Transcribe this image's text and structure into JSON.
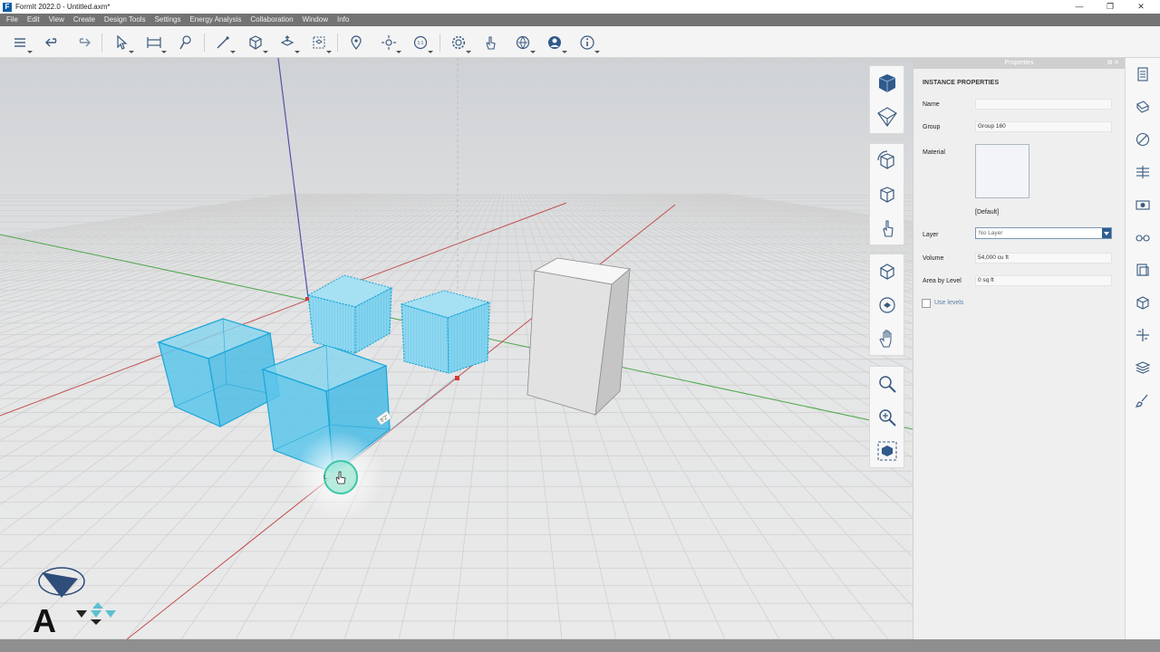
{
  "window": {
    "title": "FormIt 2022.0 - Untitled.axm*",
    "logo_letter": "F",
    "controls": {
      "minimize": "—",
      "restore": "❐",
      "close": "✕"
    }
  },
  "menu": [
    "File",
    "Edit",
    "View",
    "Create",
    "Design Tools",
    "Settings",
    "Energy Analysis",
    "Collaboration",
    "Window",
    "Info"
  ],
  "toolbar": {
    "buttons": [
      "layers-icon",
      "undo-icon",
      "redo-icon",
      "select-icon",
      "tape-measure-icon",
      "paint-icon",
      "draw-line-icon",
      "cube-primitive-icon",
      "push-pull-icon",
      "group-icon",
      "location-icon",
      "sun-icon",
      "scale-icon",
      "settings-icon",
      "hand-gesture-icon",
      "share-icon",
      "account-icon",
      "info-icon"
    ]
  },
  "viewport": {
    "dimension_label": "8'2\"",
    "colors": {
      "selection_fill": "#5cc6ea",
      "selection_stroke": "#1aa3d6",
      "x_axis": "#c04a4a",
      "y_axis": "#3e9c3e",
      "z_axis": "#4b4ba8",
      "ground_grid": "#d4d4d4"
    }
  },
  "nav_toolbar": {
    "group1": [
      "view-cube-icon",
      "perspective-icon"
    ],
    "group2": [
      "orbit-cube-icon",
      "look-cube-icon",
      "walk-icon"
    ],
    "group3": [
      "orbit-icon",
      "look-around-icon",
      "pan-hand-icon"
    ],
    "group4": [
      "zoom-icon",
      "zoom-window-icon",
      "zoom-extents-icon"
    ]
  },
  "properties": {
    "header": "Properties",
    "header_buttons": "⧉ ✕",
    "section": "INSTANCE PROPERTIES",
    "fields": {
      "name_label": "Name",
      "name_value": "",
      "group_label": "Group",
      "group_value": "Group 160",
      "material_label": "Material",
      "material_value": "[Default]",
      "layer_label": "Layer",
      "layer_value": "No Layer",
      "volume_label": "Volume",
      "volume_value": "54,000 cu ft",
      "area_label": "Area by Level",
      "area_value": "0 sq ft",
      "use_levels_label": "Use levels"
    }
  },
  "dock": [
    "properties-icon",
    "materials-icon",
    "sketch-icon",
    "levels-icon",
    "scenes-icon",
    "visual-style-icon",
    "components-icon",
    "groups-icon",
    "plugins-icon",
    "layers-panel-icon",
    "paint-palette-icon"
  ],
  "logos": {
    "autodesk_letter": "A"
  }
}
